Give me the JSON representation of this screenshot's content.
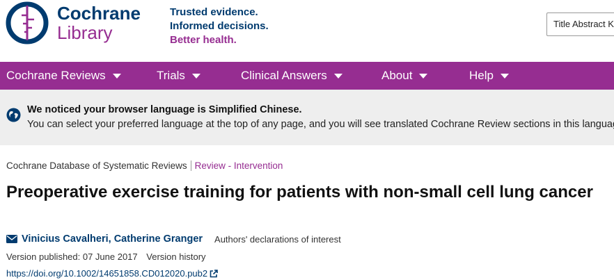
{
  "header": {
    "logo": {
      "line1": "Cochrane",
      "line2": "Library"
    },
    "tagline": {
      "line1": "Trusted evidence.",
      "line2": "Informed decisions.",
      "line3": "Better health."
    },
    "search_scope": "Title Abstract Keyword"
  },
  "nav": {
    "items": [
      {
        "label": "Cochrane Reviews"
      },
      {
        "label": "Trials"
      },
      {
        "label": "Clinical Answers"
      },
      {
        "label": "About"
      },
      {
        "label": "Help"
      }
    ]
  },
  "notice": {
    "title": "We noticed your browser language is Simplified Chinese.",
    "text": "You can select your preferred language at the top of any page, and you will see translated Cochrane Review sections in this language."
  },
  "article": {
    "database": "Cochrane Database of Systematic Reviews",
    "type": "Review - Intervention",
    "title": "Preoperative exercise training for patients with non-small cell lung cancer",
    "authors": "Vinicius Cavalheri, Catherine Granger",
    "declarations": "Authors' declarations of interest",
    "version_published": "Version published: 07 June 2017",
    "version_history": "Version history",
    "doi": "https://doi.org/10.1002/14651858.CD012020.pub2"
  },
  "colors": {
    "brand_purple": "#962d91",
    "brand_blue": "#003b6f",
    "notice_bg": "#eeeeee"
  },
  "icons": [
    "cochrane-logo-icon",
    "caret-down-icon",
    "globe-icon",
    "envelope-icon",
    "external-link-icon"
  ]
}
